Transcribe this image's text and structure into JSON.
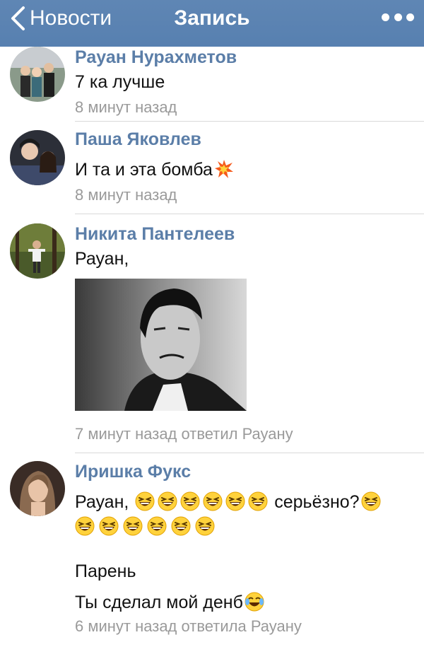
{
  "nav": {
    "back_label": "Новости",
    "title": "Запись",
    "bar_color": "#5b82b2"
  },
  "comments": [
    {
      "author": "Рауан Нурахметов",
      "text": "7 ка лучше",
      "meta": "8 минут назад"
    },
    {
      "author": "Паша Яковлев",
      "text": "И та и эта бомба",
      "emoji": "collision",
      "meta": "8 минут назад"
    },
    {
      "author": "Никита Пантелеев",
      "text": "Рауан,",
      "attachment": "photo",
      "meta": "7 минут назад ответил Рауану"
    },
    {
      "author": "Иришка Фукс",
      "line1_prefix": "Рауан,",
      "line1_suffix": "серьёзно?",
      "emoji": "laughing",
      "line3": "Парень",
      "line4": "Ты сделал мой денб",
      "line4_emoji": "tears-of-joy",
      "meta": "6 минут назад ответила Рауану"
    }
  ],
  "colors": {
    "author": "#5b7ea8",
    "meta": "#9a9a9a"
  }
}
